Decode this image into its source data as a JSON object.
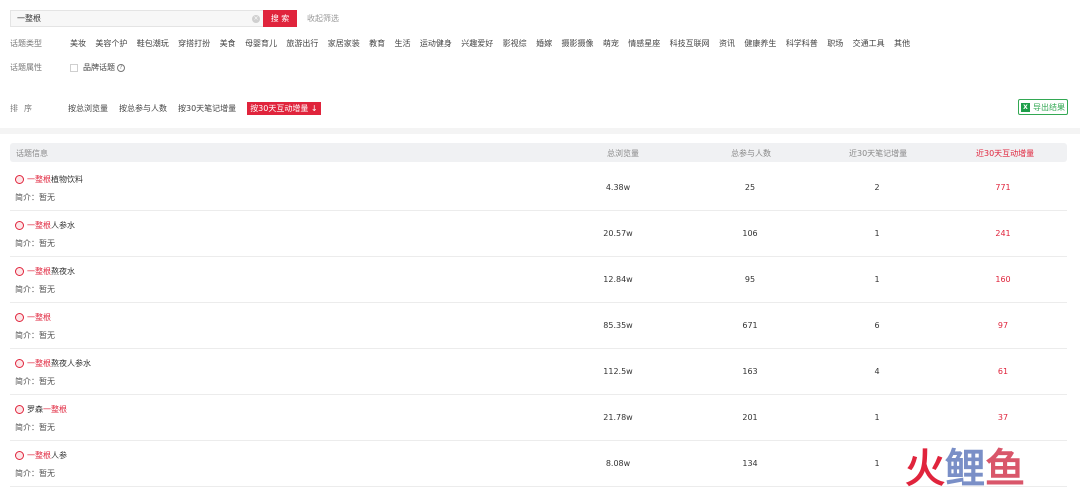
{
  "search": {
    "value": "一整根",
    "clear": "×",
    "button": "搜 索",
    "collapse": "收起筛选"
  },
  "filters": {
    "type_label": "话题类型",
    "types": [
      "美妆",
      "美容个护",
      "鞋包潮玩",
      "穿搭打扮",
      "美食",
      "母婴育儿",
      "旅游出行",
      "家居家装",
      "教育",
      "生活",
      "运动健身",
      "兴趣爱好",
      "影视综",
      "婚嫁",
      "摄影摄像",
      "萌宠",
      "情感星座",
      "科技互联网",
      "资讯",
      "健康养生",
      "科学科普",
      "职场",
      "交通工具",
      "其他"
    ],
    "attr_label": "话题属性",
    "attr_option": "品牌话题",
    "help": "?"
  },
  "sort": {
    "label": "排序",
    "options": [
      "按总浏览量",
      "按总参与人数",
      "按30天笔记增量",
      "按30天互动增量 ↓"
    ]
  },
  "export": {
    "icon": "X",
    "label": "导出结果"
  },
  "table": {
    "headers": [
      "话题信息",
      "总浏览量",
      "总参与人数",
      "近30天笔记增量",
      "近30天互动增量"
    ],
    "intro_label": "简介：暂无",
    "rows": [
      {
        "pre": "",
        "hl": "一整根",
        "post": "植物饮料",
        "views": "4.38w",
        "participants": "25",
        "notes": "2",
        "interactions": "771"
      },
      {
        "pre": "",
        "hl": "一整根",
        "post": "人参水",
        "views": "20.57w",
        "participants": "106",
        "notes": "1",
        "interactions": "241"
      },
      {
        "pre": "",
        "hl": "一整根",
        "post": "熬夜水",
        "views": "12.84w",
        "participants": "95",
        "notes": "1",
        "interactions": "160"
      },
      {
        "pre": "",
        "hl": "一整根",
        "post": "",
        "views": "85.35w",
        "participants": "671",
        "notes": "6",
        "interactions": "97"
      },
      {
        "pre": "",
        "hl": "一整根",
        "post": "熬夜人参水",
        "views": "112.5w",
        "participants": "163",
        "notes": "4",
        "interactions": "61"
      },
      {
        "pre": "罗森",
        "hl": "一整根",
        "post": "",
        "views": "21.78w",
        "participants": "201",
        "notes": "1",
        "interactions": "37"
      },
      {
        "pre": "",
        "hl": "一整根",
        "post": "人参",
        "views": "8.08w",
        "participants": "134",
        "notes": "1",
        "interactions": ""
      }
    ]
  },
  "watermark": {
    "c1": "火",
    "c2": "鲤",
    "c3": "鱼"
  },
  "colors": {
    "accent": "#e0243c",
    "export": "#33a853"
  }
}
